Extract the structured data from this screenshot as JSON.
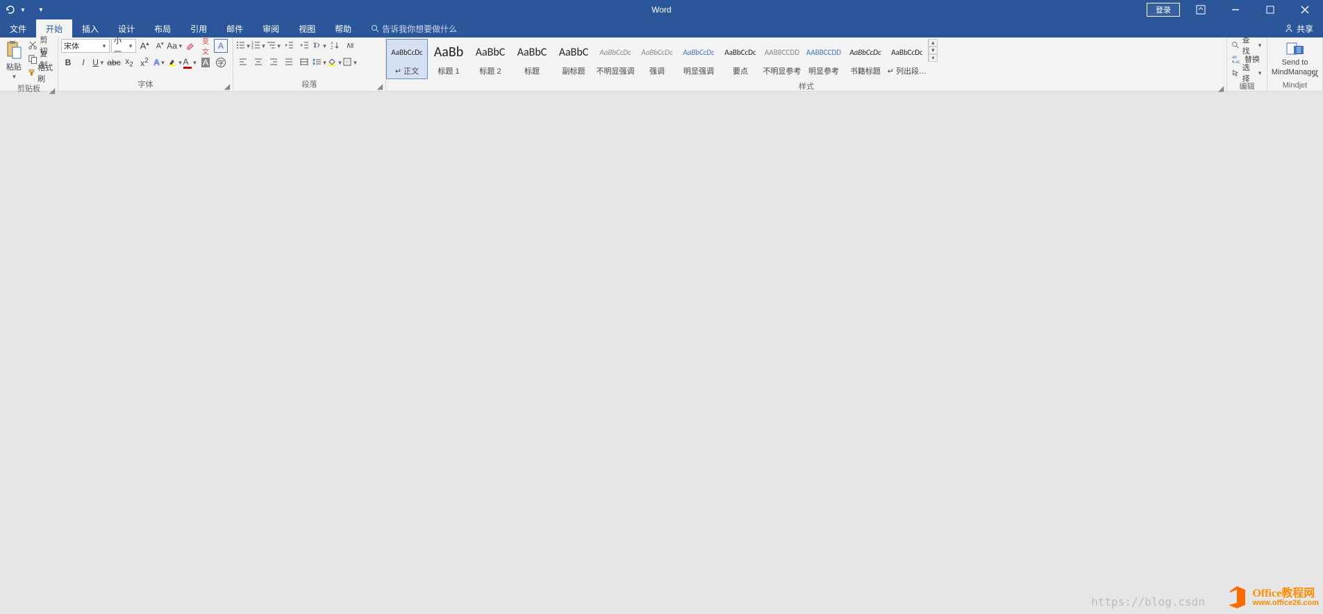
{
  "app": {
    "title": "Word"
  },
  "qat": {
    "undo": "undo",
    "customize": "customize"
  },
  "titleRight": {
    "login": "登录"
  },
  "tabs": {
    "file": "文件",
    "home": "开始",
    "insert": "插入",
    "design": "设计",
    "layout": "布局",
    "references": "引用",
    "mailings": "邮件",
    "review": "审阅",
    "view": "视图",
    "help": "帮助"
  },
  "tellme": {
    "placeholder": "告诉我你想要做什么"
  },
  "share": {
    "label": "共享"
  },
  "clipboard": {
    "groupLabel": "剪贴板",
    "paste": "粘贴",
    "cut": "剪切",
    "copy": "复制",
    "formatPainter": "格式刷"
  },
  "font": {
    "groupLabel": "字体",
    "fontName": "宋体",
    "fontSize": "小一"
  },
  "paragraph": {
    "groupLabel": "段落"
  },
  "styles": {
    "groupLabel": "样式",
    "items": [
      {
        "preview": "AaBbCcDc",
        "label": "↵ 正文",
        "color": "#222",
        "size": "11px",
        "italic": false
      },
      {
        "preview": "AaBb",
        "label": "标题 1",
        "color": "#222",
        "size": "20px",
        "italic": false
      },
      {
        "preview": "AaBbC",
        "label": "标题 2",
        "color": "#222",
        "size": "16px",
        "italic": false
      },
      {
        "preview": "AaBbC",
        "label": "标题",
        "color": "#222",
        "size": "16px",
        "italic": false
      },
      {
        "preview": "AaBbC",
        "label": "副标题",
        "color": "#222",
        "size": "16px",
        "italic": false
      },
      {
        "preview": "AaBbCcDc",
        "label": "不明显强调",
        "color": "#888",
        "size": "11px",
        "italic": true
      },
      {
        "preview": "AaBbCcDc",
        "label": "强调",
        "color": "#888",
        "size": "11px",
        "italic": true
      },
      {
        "preview": "AaBbCcDc",
        "label": "明显强调",
        "color": "#4472c4",
        "size": "11px",
        "italic": true
      },
      {
        "preview": "AaBbCcDc",
        "label": "要点",
        "color": "#222",
        "size": "11px",
        "italic": false
      },
      {
        "preview": "AABBCCDD",
        "label": "不明显参考",
        "color": "#888",
        "size": "11px",
        "italic": false
      },
      {
        "preview": "AABBCCDD",
        "label": "明显参考",
        "color": "#4472c4",
        "size": "11px",
        "italic": false
      },
      {
        "preview": "AaBbCcDc",
        "label": "书籍标题",
        "color": "#222",
        "size": "11px",
        "italic": true
      },
      {
        "preview": "AaBbCcDc",
        "label": "↵ 列出段…",
        "color": "#222",
        "size": "11px",
        "italic": false
      }
    ]
  },
  "editing": {
    "groupLabel": "编辑",
    "find": "查找",
    "replace": "替换",
    "select": "选择"
  },
  "mindjet": {
    "groupLabel": "Mindjet",
    "sendLine1": "Send to",
    "sendLine2": "MindManager"
  },
  "watermark": {
    "url": "https://blog.csdn",
    "logoCn": "Office教程网",
    "logoEn": "www.office26.com"
  }
}
